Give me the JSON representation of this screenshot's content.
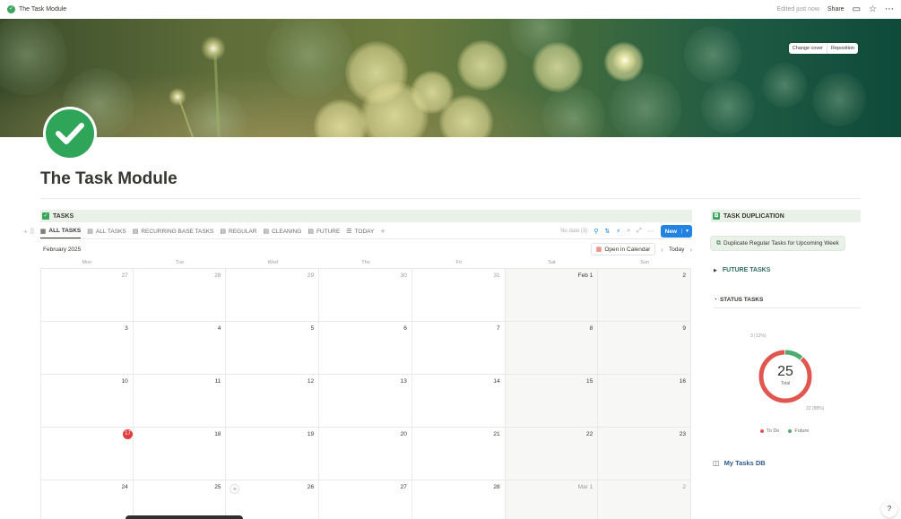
{
  "topbar": {
    "page_title": "The Task Module",
    "edited": "Edited just now",
    "share": "Share",
    "comment_icon": "comment-icon",
    "star_icon": "star-icon",
    "more_icon": "more-icon"
  },
  "cover": {
    "change_cover": "Change cover",
    "reposition": "Reposition"
  },
  "page": {
    "title": "The Task Module"
  },
  "tasks": {
    "header": "TASKS",
    "tabs": [
      "ALL TASKS",
      "ALL TASKS",
      "RECURRING BASE TASKS",
      "REGULAR",
      "CLEANING",
      "FUTURE",
      "TODAY"
    ],
    "no_date": "No date (3)",
    "new_label": "New",
    "month": "February 2025",
    "open_calendar": "Open in Calendar",
    "today": "Today",
    "weekdays": [
      "Mon",
      "Tue",
      "Wed",
      "Thu",
      "Fri",
      "Sat",
      "Sun"
    ],
    "weeks": [
      [
        "27",
        "28",
        "29",
        "30",
        "31",
        "Feb 1",
        "2"
      ],
      [
        "3",
        "4",
        "5",
        "6",
        "7",
        "8",
        "9"
      ],
      [
        "10",
        "11",
        "12",
        "13",
        "14",
        "15",
        "16"
      ],
      [
        "17",
        "18",
        "19",
        "20",
        "21",
        "22",
        "23"
      ],
      [
        "24",
        "25",
        "26",
        "27",
        "28",
        "Mar 1",
        "2"
      ]
    ]
  },
  "sidebar": {
    "duplication_header": "TASK DUPLICATION",
    "duplicate_button": "Duplicate Regular Tasks for Upcoming Week",
    "future_tasks": "FUTURE TASKS",
    "status_header": "STATUS TASKS",
    "my_tasks": "My Tasks DB"
  },
  "chart_data": {
    "type": "pie",
    "center_value": "25",
    "center_label": "Total",
    "series": [
      {
        "name": "To Do",
        "value": 22,
        "label": "22 (88%)",
        "color": "#e0574f"
      },
      {
        "name": "Future",
        "value": 3,
        "label": "3 (12%)",
        "color": "#4dab6f"
      }
    ],
    "legend": "bottom"
  }
}
